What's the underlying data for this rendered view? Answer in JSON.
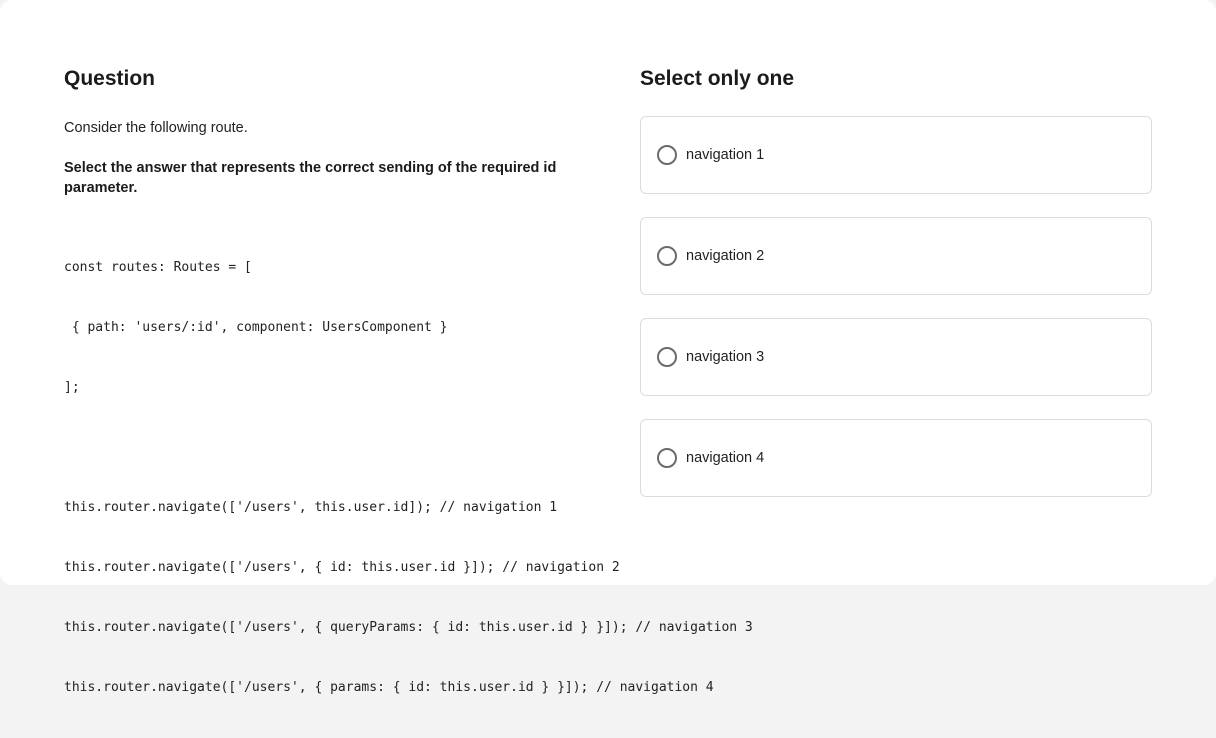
{
  "question": {
    "heading": "Question",
    "intro": "Consider the following route.",
    "instruction": "Select the answer that represents the correct sending of the required id parameter.",
    "code_lines": [
      "const routes: Routes = [",
      " { path: 'users/:id', component: UsersComponent }",
      "];",
      "",
      "this.router.navigate(['/users', this.user.id]); // navigation 1",
      "this.router.navigate(['/users', { id: this.user.id }]); // navigation 2",
      "this.router.navigate(['/users', { queryParams: { id: this.user.id } }]); // navigation 3",
      "this.router.navigate(['/users', { params: { id: this.user.id } }]); // navigation 4"
    ]
  },
  "answers": {
    "heading": "Select only one",
    "options": [
      {
        "label": "navigation 1",
        "selected": false
      },
      {
        "label": "navigation 2",
        "selected": false
      },
      {
        "label": "navigation 3",
        "selected": false
      },
      {
        "label": "navigation 4",
        "selected": false
      }
    ]
  }
}
